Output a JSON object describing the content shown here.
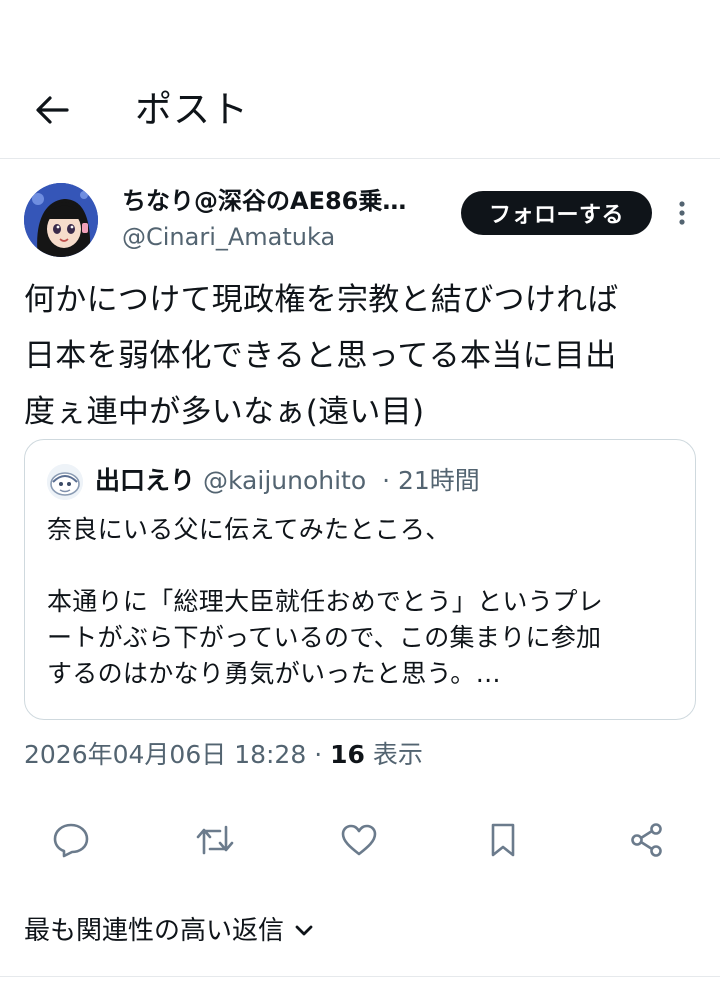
{
  "header": {
    "title": "ポスト",
    "back_icon": "arrow-left-icon"
  },
  "author": {
    "name": "ちなり@深谷のAE86乗…",
    "handle": "@Cinari_Amatuka",
    "follow_label": "フォローする",
    "more_icon": "more-vertical-icon"
  },
  "post": {
    "lines": [
      "何かにつけて現政権を宗教と結びつければ",
      "日本を弱体化できると思ってる本当に目出",
      "度ぇ連中が多いなぁ(遠い目)"
    ]
  },
  "quote": {
    "name": "出口えり",
    "handle": "@kaijunohito",
    "time": "· 21時間",
    "lines": [
      "奈良にいる父に伝えてみたところ、",
      "本通りに「総理大臣就任おめでとう」というプレ",
      "ートがぶら下がっているので、この集まりに参加",
      "するのはかなり勇気がいったと思う。…"
    ]
  },
  "meta": {
    "timestamp": "2026年04月06日 18:28",
    "separator": "·",
    "views_count": "16",
    "views_label": "表示"
  },
  "actions": [
    "reply-icon",
    "repost-icon",
    "like-icon",
    "bookmark-icon",
    "share-icon"
  ],
  "replies": {
    "sort_label": "最も関連性の高い返信"
  },
  "colors": {
    "text": "#0f1419",
    "secondary": "#536471",
    "border": "#cfd9de",
    "follow_bg": "#0f1419"
  }
}
